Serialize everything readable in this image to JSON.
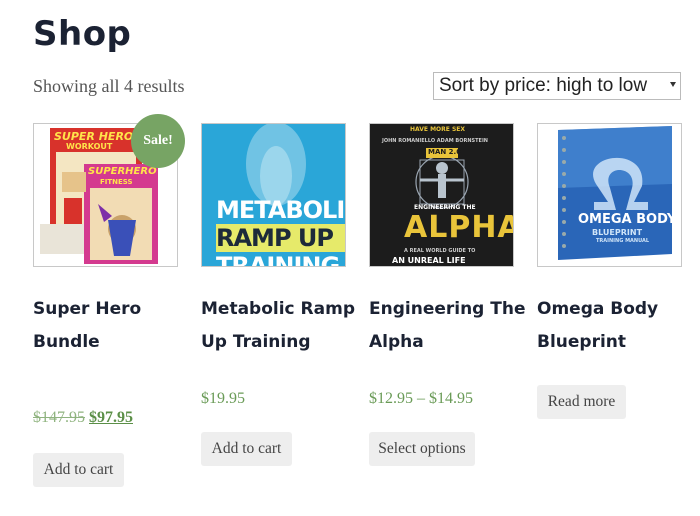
{
  "header": {
    "title": "Shop"
  },
  "toolbar": {
    "result_count": "Showing all 4 results",
    "sort": {
      "selected": "Sort by price: high to low"
    }
  },
  "colors": {
    "accent_green": "#77a464",
    "price_green": "#6a9b57",
    "title": "#1b2233",
    "button_bg": "#eeeeee"
  },
  "products": [
    {
      "title": "Super Hero Bundle",
      "badge": "Sale!",
      "regular_price": "$147.95",
      "sale_price": "$97.95",
      "button": "Add to cart",
      "cover": {
        "top_line": "SUPER HERO",
        "top_sub": "WORKOUT",
        "bottom_line": "SUPERHERO",
        "bottom_sub": "FITNESS"
      }
    },
    {
      "title": "Metabolic Ramp Up Training",
      "price": "$19.95",
      "button": "Add to cart",
      "cover": {
        "line1": "METABOLIC",
        "line2": "RAMP UP",
        "line3": "TRAINING"
      }
    },
    {
      "title": "Engineering The Alpha",
      "price": "$12.95 – $14.95",
      "button": "Select options",
      "cover": {
        "top": "HAVE MORE SEX",
        "authors": "JOHN ROMANIELLO   ADAM BORNSTEIN",
        "tag": "MAN 2.0",
        "small": "ENGINEERING THE",
        "big": "ALPHA",
        "sub": "A REAL WORLD GUIDE TO",
        "bottom": "AN UNREAL LIFE"
      }
    },
    {
      "title": "Omega Body Blueprint",
      "button": "Read more",
      "cover": {
        "line1": "OMEGA BODY",
        "line2": "BLUEPRINT",
        "line3": "TRAINING MANUAL"
      }
    }
  ]
}
